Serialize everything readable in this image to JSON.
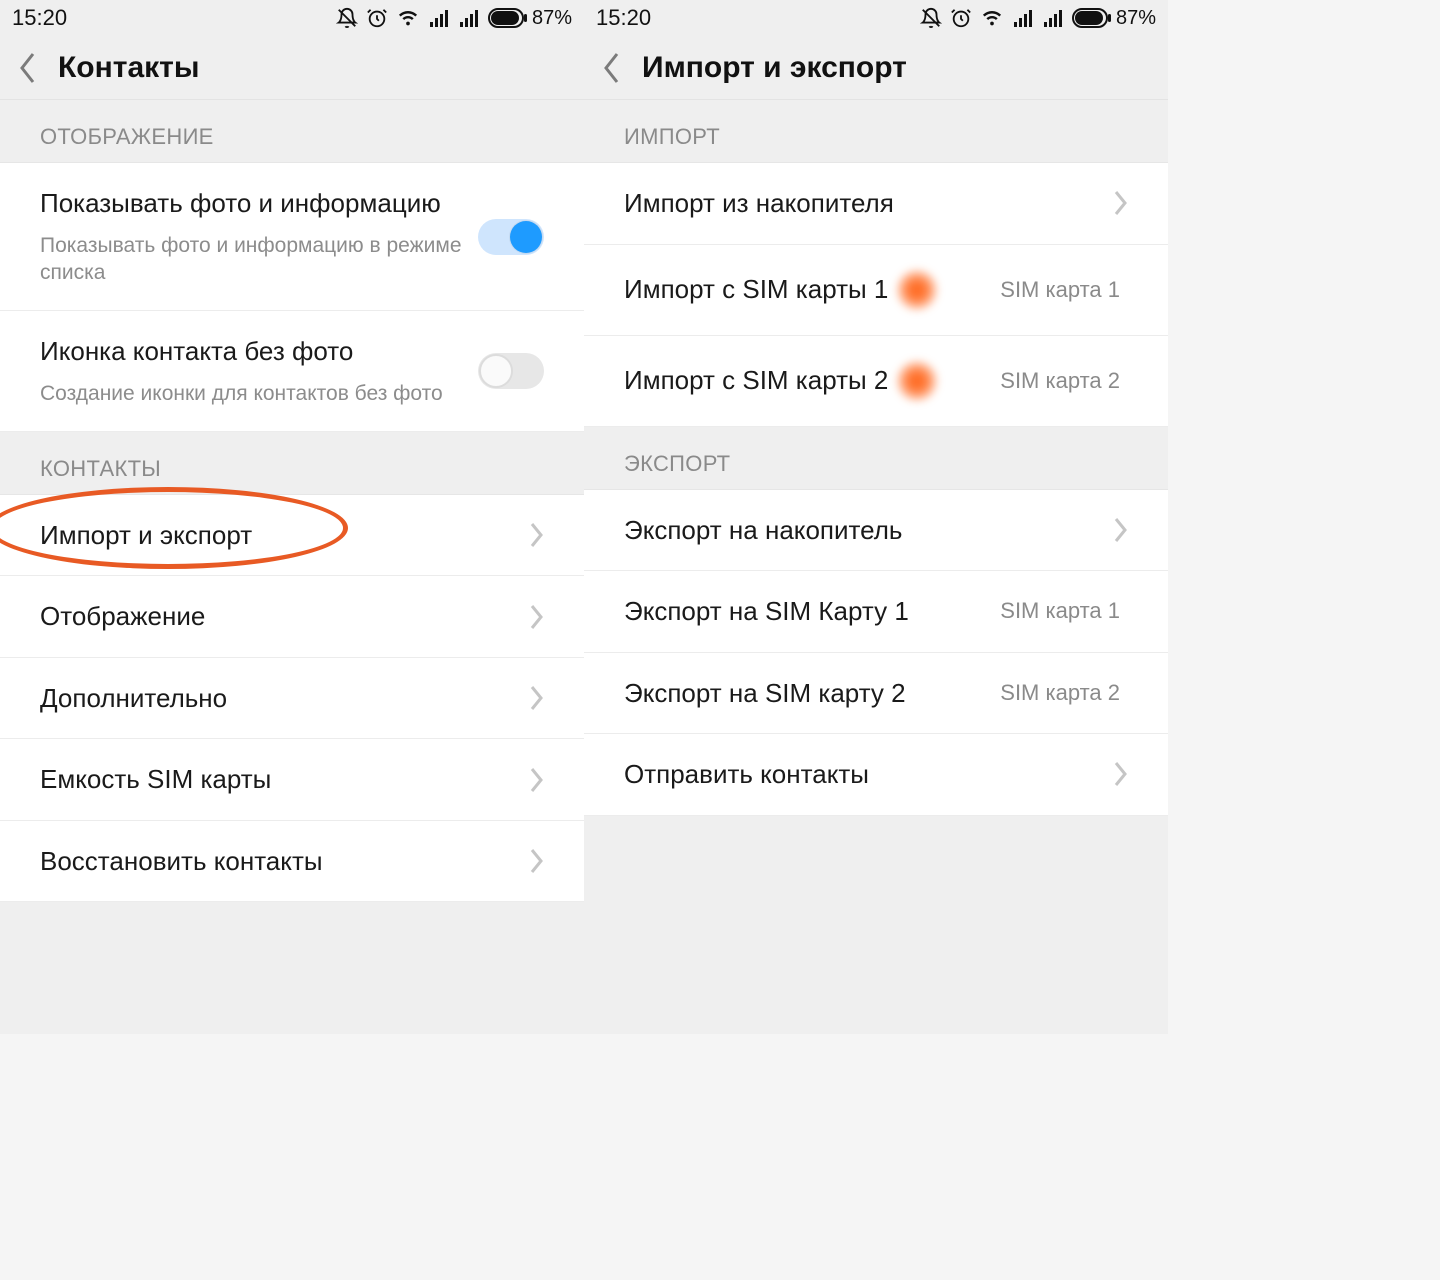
{
  "status": {
    "time": "15:20",
    "battery_percent": "87%"
  },
  "left": {
    "title": "Контакты",
    "section_display": "ОТОБРАЖЕНИЕ",
    "show_photo_title": "Показывать фото и информацию",
    "show_photo_sub": "Показывать фото и информацию в режиме списка",
    "icon_nophoto_title": "Иконка контакта без фото",
    "icon_nophoto_sub": "Создание иконки для контактов без фото",
    "section_contacts": "КОНТАКТЫ",
    "import_export": "Импорт и экспорт",
    "display": "Отображение",
    "more": "Дополнительно",
    "sim_capacity": "Емкость SIM карты",
    "restore": "Восстановить контакты"
  },
  "right": {
    "title": "Импорт и экспорт",
    "section_import": "ИМПОРТ",
    "import_storage": "Импорт из накопителя",
    "import_sim1": "Импорт с SIM карты 1",
    "import_sim1_val": "SIM карта 1",
    "import_sim2": "Импорт с SIM карты 2",
    "import_sim2_val": "SIM карта 2",
    "section_export": "ЭКСПОРТ",
    "export_storage": "Экспорт на накопитель",
    "export_sim1": "Экспорт на SIM Карту 1",
    "export_sim1_val": "SIM карта 1",
    "export_sim2": "Экспорт на SIM карту 2",
    "export_sim2_val": "SIM карта 2",
    "send_contacts": "Отправить контакты"
  }
}
